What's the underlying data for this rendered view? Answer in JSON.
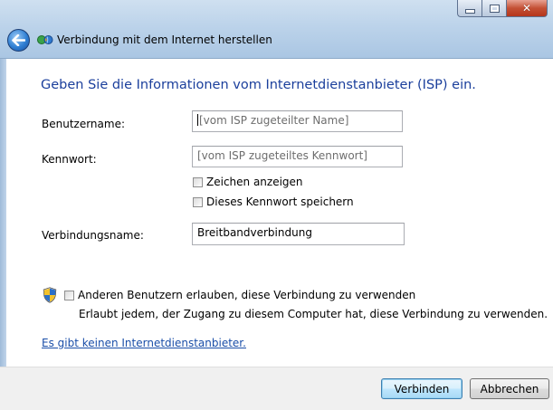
{
  "window": {
    "title": "Verbindung mit dem Internet herstellen"
  },
  "content": {
    "heading": "Geben Sie die Informationen vom Internetdienstanbieter (ISP) ein.",
    "username_label": "Benutzername:",
    "username_placeholder": "[vom ISP zugeteilter Name]",
    "password_label": "Kennwort:",
    "password_placeholder": "[vom ISP zugeteiltes Kennwort]",
    "show_chars_label": "Zeichen anzeigen",
    "show_chars_checked": false,
    "save_password_label": "Dieses Kennwort speichern",
    "save_password_checked": false,
    "connection_name_label": "Verbindungsname:",
    "connection_name_value": "Breitbandverbindung",
    "allow_others_label": "Anderen Benutzern erlauben, diese Verbindung zu verwenden",
    "allow_others_checked": false,
    "allow_others_desc": "Erlaubt jedem, der Zugang zu diesem Computer hat, diese Verbindung zu verwenden.",
    "no_isp_link": "Es gibt keinen Internetdienstanbieter."
  },
  "footer": {
    "connect_label": "Verbinden",
    "cancel_label": "Abbrechen"
  },
  "icons": {
    "back": "back-arrow-icon",
    "app": "network-globe-icon",
    "shield": "uac-shield-icon",
    "minimize": "minimize-icon",
    "maximize": "maximize-icon",
    "close": "close-icon"
  },
  "colors": {
    "heading": "#1b3f9c",
    "link": "#1a4ea8",
    "default_button_border": "#3c7fb1"
  }
}
